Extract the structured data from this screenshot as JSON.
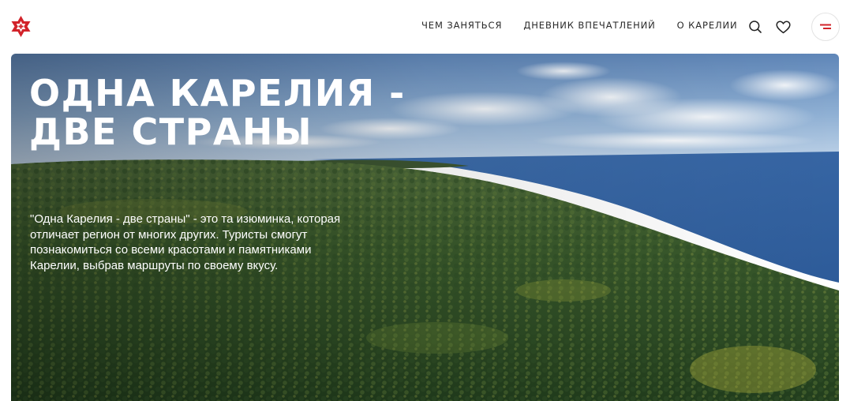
{
  "header": {
    "logo_icon": "karelia-star-icon",
    "brand_color": "#d2232a",
    "nav": [
      {
        "label": "ЧЕМ ЗАНЯТЬСЯ"
      },
      {
        "label": "ДНЕВНИК ВПЕЧАТЛЕНИЙ"
      },
      {
        "label": "О КАРЕЛИИ"
      }
    ],
    "icons": [
      "search-icon",
      "heart-icon",
      "menu-icon"
    ]
  },
  "hero": {
    "title": "ОДНА КАРЕЛИЯ - ДВЕ СТРАНЫ",
    "description": "\"Одна Карелия - две страны\" - это та изюминка, которая отличает регион от многих других. Туристы смогут познакомиться со всеми красотами и памятниками Карелии, выбрав маршруты по своему вкусу."
  }
}
